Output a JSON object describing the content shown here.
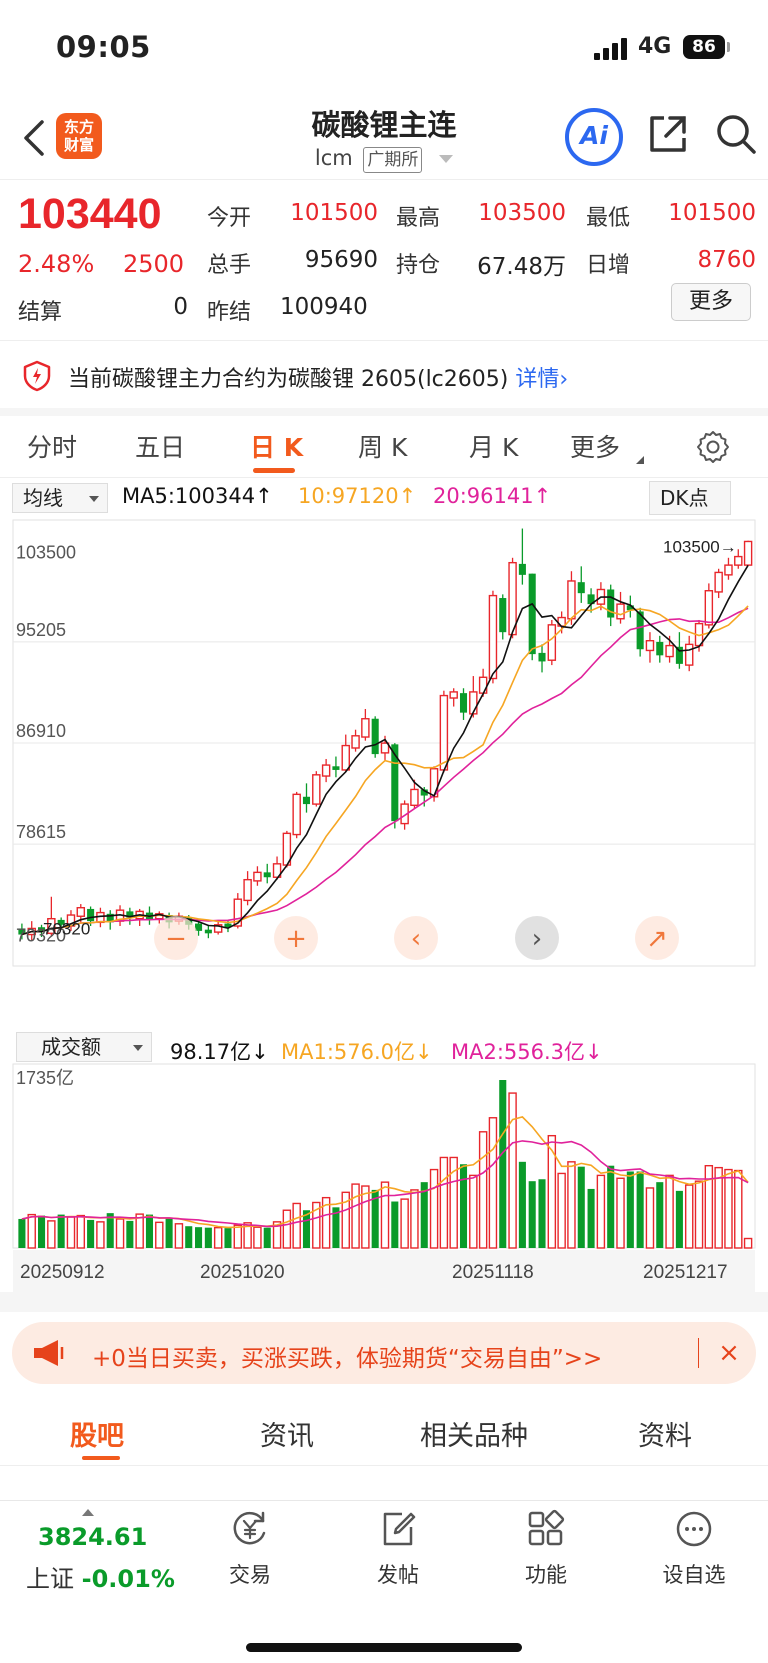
{
  "status_bar": {
    "time": "09:05",
    "network": "4G",
    "battery": "86"
  },
  "header": {
    "logo_line1": "东方",
    "logo_line2": "财富",
    "title": "碳酸锂主连",
    "code": "lcm",
    "exchange": "广期所",
    "ai_label": "Ai"
  },
  "quote": {
    "price": "103440",
    "change_pct": "2.48%",
    "change": "2500",
    "settle_label": "结算",
    "settle": "0",
    "open_label": "今开",
    "open": "101500",
    "high_label": "最高",
    "high": "103500",
    "low_label": "最低",
    "low": "101500",
    "volume_label": "总手",
    "volume": "95690",
    "oi_label": "持仓",
    "oi": "67.48万",
    "daily_inc_label": "日增",
    "daily_inc": "8760",
    "prev_settle_label": "昨结",
    "prev_settle": "100940",
    "more_label": "更多"
  },
  "notice": {
    "text": "当前碳酸锂主力合约为碳酸锂 2605(lc2605)",
    "link": "详情›"
  },
  "tabs": [
    "分时",
    "五日",
    "日 K",
    "周 K",
    "月 K",
    "更多"
  ],
  "indicators": {
    "main_select": "均线",
    "ma5": "MA5:100344↑",
    "ma10": "10:97120↑",
    "ma20": "20:96141↑",
    "dk_label": "DK点",
    "vol_select": "成交额",
    "vol_value": "98.17亿↓",
    "vol_ma1": "MA1:576.0亿↓",
    "vol_ma2": "MA2:556.3亿↓"
  },
  "chart_data": {
    "type": "candlestick",
    "y_ticks": [
      "103500",
      "95205",
      "86910",
      "78615",
      "70320"
    ],
    "ylim": [
      70320,
      103500
    ],
    "high_marker": "103500→",
    "low_marker": "70320",
    "vol_top_label": "1735亿",
    "vol_max": 1735,
    "x_labels": [
      "20250912",
      "20251020",
      "20251118",
      "20251217"
    ],
    "candles": [
      [
        71700,
        71200,
        72100,
        70800
      ],
      [
        71200,
        71700,
        72300,
        70700
      ],
      [
        71800,
        71400,
        72000,
        71000
      ],
      [
        71300,
        72500,
        74300,
        71100
      ],
      [
        72400,
        72000,
        72600,
        71600
      ],
      [
        71900,
        72800,
        73200,
        71500
      ],
      [
        72700,
        73400,
        73700,
        72200
      ],
      [
        73300,
        72300,
        73500,
        71900
      ],
      [
        72200,
        73000,
        73400,
        71800
      ],
      [
        72900,
        72200,
        73200,
        71600
      ],
      [
        72300,
        73200,
        73600,
        71900
      ],
      [
        73100,
        72600,
        73400,
        72000
      ],
      [
        72500,
        73100,
        73300,
        71900
      ],
      [
        73000,
        72400,
        73500,
        72000
      ],
      [
        72500,
        72900,
        73100,
        72100
      ],
      [
        72800,
        72200,
        73000,
        71700
      ],
      [
        72300,
        72700,
        73000,
        72000
      ],
      [
        72600,
        72000,
        72800,
        71600
      ],
      [
        72100,
        71500,
        72400,
        71100
      ],
      [
        71600,
        71300,
        72000,
        70900
      ],
      [
        71400,
        72000,
        72300,
        71200
      ],
      [
        72100,
        71800,
        72400,
        71400
      ],
      [
        71900,
        74100,
        74600,
        71700
      ],
      [
        74000,
        75700,
        76400,
        73600
      ],
      [
        75600,
        76300,
        76800,
        75200
      ],
      [
        76300,
        75900,
        77000,
        75400
      ],
      [
        75900,
        77000,
        77600,
        75700
      ],
      [
        76900,
        79500,
        79700,
        76700
      ],
      [
        79400,
        82700,
        82900,
        79100
      ],
      [
        82500,
        81900,
        83600,
        81200
      ],
      [
        81900,
        84300,
        84600,
        81700
      ],
      [
        84200,
        85100,
        85600,
        83700
      ],
      [
        85000,
        84700,
        85800,
        84100
      ],
      [
        84700,
        86700,
        87600,
        84500
      ],
      [
        86500,
        87500,
        88000,
        86200
      ],
      [
        87400,
        88900,
        89700,
        87100
      ],
      [
        88900,
        86000,
        89100,
        85700
      ],
      [
        86100,
        86900,
        87500,
        85500
      ],
      [
        86800,
        80500,
        86900,
        79900
      ],
      [
        80300,
        81900,
        82200,
        79800
      ],
      [
        81800,
        83100,
        83900,
        81500
      ],
      [
        83100,
        82600,
        83300,
        81700
      ],
      [
        82500,
        84800,
        85000,
        82100
      ],
      [
        84700,
        90800,
        91200,
        84500
      ],
      [
        90600,
        91100,
        91400,
        89900
      ],
      [
        91000,
        89400,
        91400,
        88800
      ],
      [
        89300,
        91100,
        92400,
        89000
      ],
      [
        91000,
        92300,
        93000,
        90700
      ],
      [
        92200,
        99000,
        99400,
        91800
      ],
      [
        98800,
        96000,
        99100,
        95400
      ],
      [
        95800,
        101700,
        102100,
        95500
      ],
      [
        101600,
        100700,
        104500,
        99900
      ],
      [
        100800,
        94200,
        100800,
        93700
      ],
      [
        94300,
        93600,
        95000,
        92700
      ],
      [
        93700,
        96600,
        97000,
        93300
      ],
      [
        96500,
        97200,
        97700,
        95900
      ],
      [
        97100,
        100200,
        101000,
        96600
      ],
      [
        100100,
        99200,
        101400,
        98400
      ],
      [
        99100,
        98300,
        99600,
        97600
      ],
      [
        98300,
        99500,
        100100,
        97800
      ],
      [
        99500,
        97200,
        99900,
        96500
      ],
      [
        97100,
        98300,
        99300,
        96700
      ],
      [
        98200,
        97800,
        99000,
        97200
      ],
      [
        97700,
        94600,
        98000,
        94000
      ],
      [
        94500,
        95300,
        96000,
        93500
      ],
      [
        95200,
        94100,
        95700,
        93500
      ],
      [
        94000,
        94900,
        95700,
        93500
      ],
      [
        94800,
        93400,
        96000,
        93000
      ],
      [
        93300,
        95000,
        95700,
        92800
      ],
      [
        94900,
        96700,
        97000,
        94400
      ],
      [
        96600,
        99400,
        100000,
        96300
      ],
      [
        99300,
        100900,
        101200,
        98800
      ],
      [
        100700,
        101500,
        102100,
        100300
      ],
      [
        101500,
        102200,
        102800,
        101200
      ],
      [
        101500,
        103440,
        103500,
        101500
      ]
    ],
    "volumes": [
      300,
      345,
      335,
      280,
      345,
      320,
      335,
      290,
      270,
      360,
      300,
      280,
      350,
      345,
      265,
      310,
      250,
      225,
      215,
      210,
      210,
      205,
      235,
      260,
      215,
      210,
      270,
      390,
      460,
      390,
      470,
      520,
      420,
      575,
      660,
      640,
      600,
      680,
      480,
      505,
      600,
      680,
      810,
      935,
      935,
      865,
      750,
      1200,
      1345,
      1735,
      1600,
      890,
      690,
      710,
      1160,
      770,
      890,
      840,
      610,
      750,
      850,
      720,
      790,
      790,
      620,
      680,
      750,
      590,
      650,
      690,
      850,
      830,
      810,
      800,
      98
    ],
    "series": [
      {
        "name": "MA5",
        "color": "#111111"
      },
      {
        "name": "MA10",
        "color": "#f6a623"
      },
      {
        "name": "MA20",
        "color": "#e0229b"
      }
    ]
  },
  "chart_buttons": [
    "−",
    "+",
    "‹",
    "›",
    "↗"
  ],
  "banner": {
    "text": "+0当日买卖，买涨买跌，体验期货“交易自由”>>",
    "close": "×"
  },
  "subtabs": [
    "股吧",
    "资讯",
    "相关品种",
    "资料"
  ],
  "bottom_nav": {
    "index_value": "3824.61",
    "index_name": "上证",
    "index_change": "-0.01%",
    "items": [
      "交易",
      "发帖",
      "功能",
      "设自选"
    ]
  }
}
